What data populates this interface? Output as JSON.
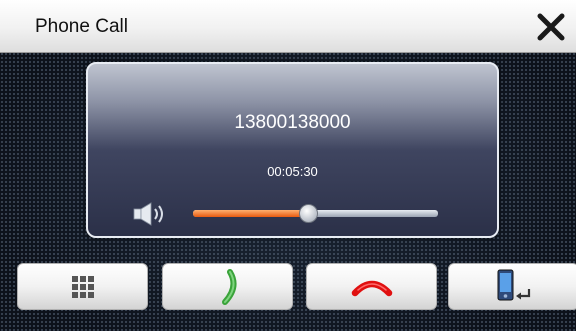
{
  "window": {
    "title": "Phone Call"
  },
  "call": {
    "number": "13800138000",
    "duration": "00:05:30",
    "volume_level_percent": 47
  },
  "icons": {
    "close": "close-x-icon",
    "speaker": "speaker-icon",
    "keypad": "dialpad-icon",
    "answer": "answer-call-icon",
    "hangup": "hangup-call-icon",
    "transfer": "transfer-to-phone-icon"
  },
  "colors": {
    "volume_fill": "#e85a10",
    "answer_handset": "#3aa33a",
    "hangup_handset": "#e01010"
  }
}
